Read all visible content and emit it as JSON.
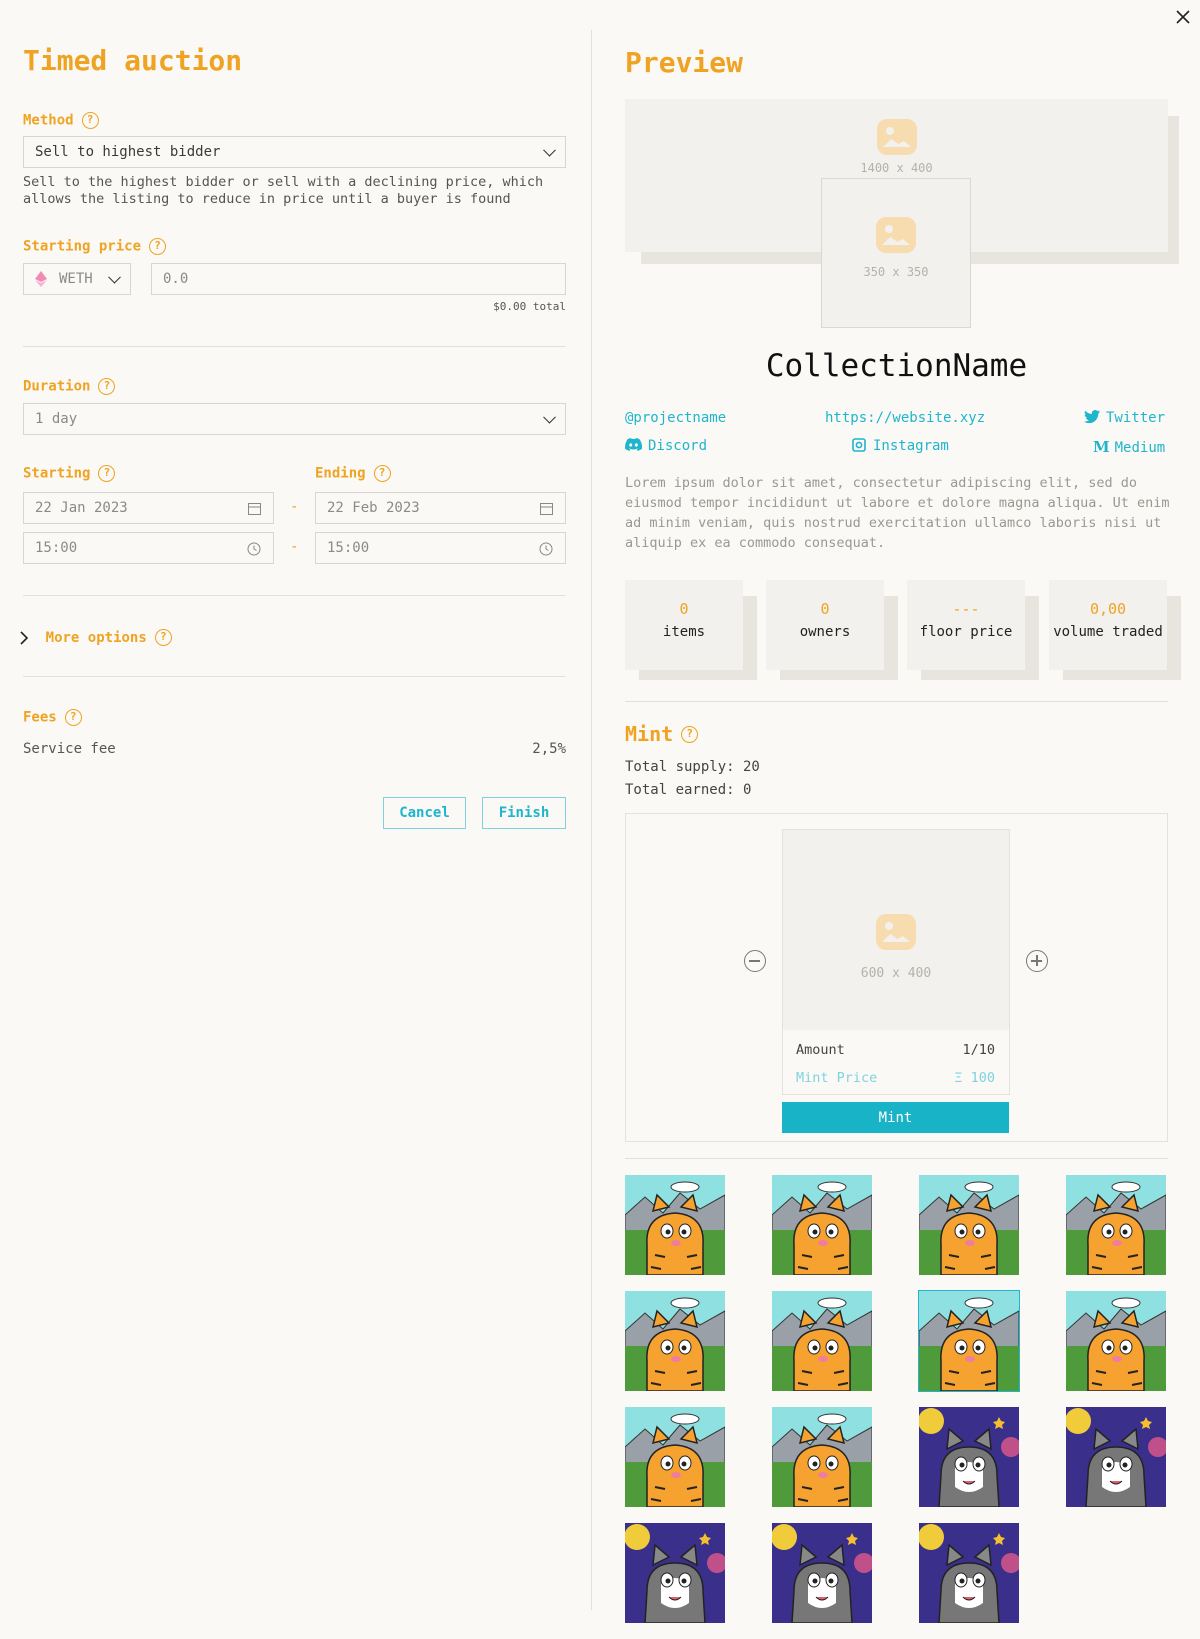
{
  "left": {
    "title": "Timed auction",
    "method": {
      "label": "Method",
      "value": "Sell to highest bidder",
      "description": "Sell to the highest bidder or sell with a declining price, which allows the listing to reduce in price until a buyer is found"
    },
    "starting_price": {
      "label": "Starting price",
      "currency": "WETH",
      "placeholder": "0.0",
      "total": "$0.00 total"
    },
    "duration": {
      "label": "Duration",
      "value": "1 day"
    },
    "starting": {
      "label": "Starting",
      "date": "22 Jan 2023",
      "time": "15:00"
    },
    "ending": {
      "label": "Ending",
      "date": "22 Feb 2023",
      "time": "15:00"
    },
    "dash": "-",
    "more_options": "More options",
    "fees": {
      "label": "Fees",
      "service_fee_label": "Service fee",
      "service_fee_value": "2,5%"
    },
    "cancel": "Cancel",
    "finish": "Finish"
  },
  "preview": {
    "title": "Preview",
    "banner_size": "1400 x 400",
    "logo_size": "350 x 350",
    "collection_name": "CollectionName",
    "links": {
      "handle": "@projectname",
      "website": "https://website.xyz",
      "twitter": "Twitter",
      "discord": "Discord",
      "instagram": "Instagram",
      "medium": "Medium"
    },
    "description": "Lorem ipsum dolor sit amet, consectetur adipiscing elit, sed do eiusmod tempor incididunt ut labore et dolore magna aliqua. Ut enim ad minim veniam, quis nostrud exercitation ullamco laboris nisi ut aliquip ex ea commodo consequat.",
    "stats": [
      {
        "value": "0",
        "label": "items"
      },
      {
        "value": "0",
        "label": "owners"
      },
      {
        "value": "---",
        "label": "floor price"
      },
      {
        "value": "0,00",
        "label": "volume traded"
      }
    ],
    "mint": {
      "title": "Mint",
      "total_supply": "Total supply: 20",
      "total_earned": "Total earned: 0",
      "image_size": "600 x 400",
      "amount_label": "Amount",
      "amount_value": "1/10",
      "price_label": "Mint Price",
      "price_value": "Ξ 100",
      "button": "Mint"
    },
    "gallery": [
      "tiger",
      "tiger",
      "tiger",
      "tiger",
      "tiger",
      "tiger",
      "tiger",
      "tiger",
      "tiger",
      "tiger",
      "space-cat",
      "space-cat",
      "space-cat",
      "space-cat",
      "space-cat"
    ],
    "selected_index": 6
  },
  "colors": {
    "accent": "#f0a322",
    "link": "#1fb5cc",
    "background": "#faf9f6"
  }
}
